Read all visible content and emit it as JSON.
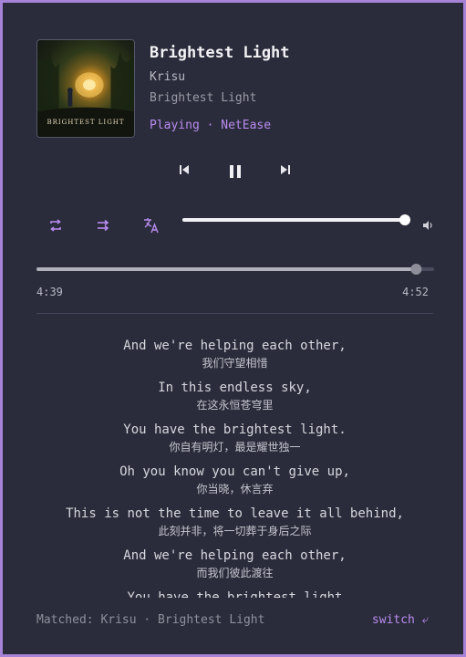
{
  "track": {
    "title": "Brightest Light",
    "artist": "Krisu",
    "album": "Brightest Light",
    "status": "Playing · NetEase"
  },
  "cover": {
    "text": "BRIGHTEST LIGHT"
  },
  "controls": {
    "previous_icon": "skip-previous-icon",
    "pause_icon": "pause-icon",
    "next_icon": "skip-next-icon",
    "repeat_icon": "repeat-icon",
    "order_icon": "sequential-play-icon",
    "translate_icon": "translate-icon",
    "volume_icon": "volume-icon",
    "volume_level": 1.0,
    "accent_color": "#b98cf0"
  },
  "progress": {
    "elapsed": "4:39",
    "duration": "4:52",
    "fraction": 0.955
  },
  "lyrics": [
    {
      "en": "And we're helping each other,",
      "zh": "我们守望相惜"
    },
    {
      "en": "In this endless sky,",
      "zh": "在这永恒苍穹里"
    },
    {
      "en": "You have the brightest light.",
      "zh": "你自有明灯，最是耀世独一"
    },
    {
      "en": "Oh you know you can't give up,",
      "zh": "你当晓，休言弃"
    },
    {
      "en": "This is not the time to leave it all behind,",
      "zh": "此刻并非，将一切葬于身后之际"
    },
    {
      "en": "And we're helping each other,",
      "zh": "而我们彼此渡往"
    },
    {
      "en": "You have the brightest light",
      "zh": ""
    }
  ],
  "footer": {
    "matched": "Matched: Krisu · Brightest Light",
    "switch_label": "switch ⤶"
  }
}
